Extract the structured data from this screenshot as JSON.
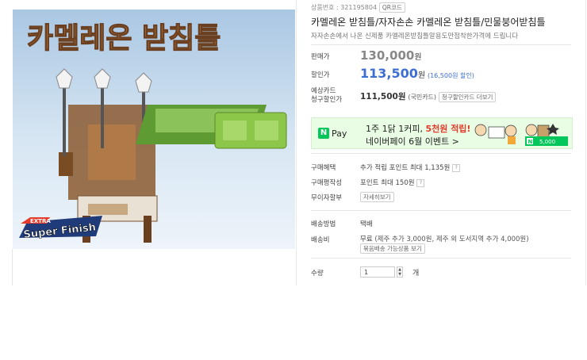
{
  "product": {
    "code_label": "상품번호 : 321195804",
    "qr_button": "QR코드",
    "title": "카멜레온 받침틀/자자손손 카멜레온 받침틀/민물붕어받침틀",
    "subtitle": "자자손손에서 나온 신제품 카멜레온받침틀알용도만점착한가격에 드립니다",
    "image_overlay_text": "카멜레온 받침틀",
    "badge_text": "Super Finish",
    "badge_extra": "EXTRA"
  },
  "price": {
    "regular_label": "판매가",
    "regular_value": "130,000",
    "regular_unit": "원",
    "sale_label": "할인가",
    "sale_value": "113,500",
    "sale_unit": "원",
    "sale_note": "(16,500원 할인)",
    "card_label_1": "예상카드",
    "card_label_2": "청구할인가",
    "card_value": "111,500원",
    "card_note": "(국민카드)",
    "card_button": "청구할인카드 더보기"
  },
  "banner": {
    "npay": "Pay",
    "line1_a": "1주 1닭 1커피, ",
    "line1_b": "5천원 적립!",
    "line2": "네이버페이 6월 이벤트 >",
    "point": "5,000"
  },
  "benefits": {
    "buy_benefit_label": "구매혜택",
    "buy_benefit_value": "추가 적립 포인트 최대 1,135원",
    "review_label": "구매평작성",
    "review_value": "포인트 최대 150원",
    "installment_label": "무이자할부",
    "installment_button": "자세히보기"
  },
  "shipping": {
    "method_label": "배송방법",
    "method_value": "택배",
    "fee_label": "배송비",
    "fee_value": "무료",
    "fee_note": "(제주 추가 3,000원, 제주 외 도서지역 추가 4,000원)",
    "bundle_button": "묶음배송 가능상품 보기"
  },
  "quantity": {
    "label": "수량",
    "value": "1",
    "unit": "개"
  },
  "colors": {
    "sale_blue": "#3d6fd2",
    "npay_green": "#03c75a",
    "banner_bg": "#e8fde4"
  }
}
